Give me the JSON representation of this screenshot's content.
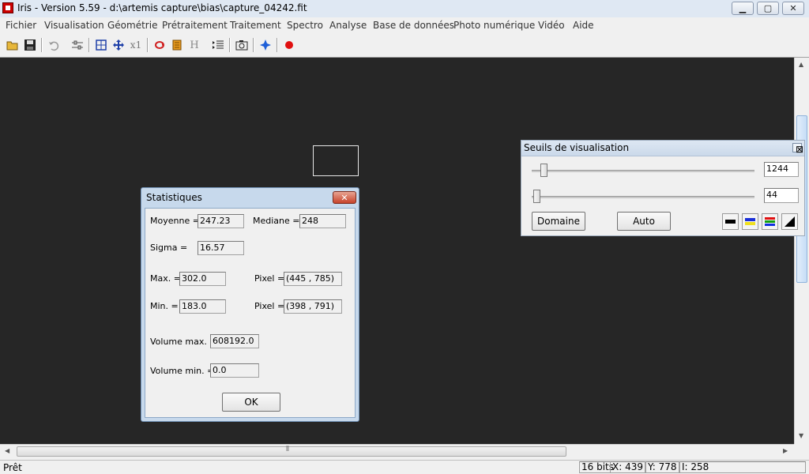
{
  "window": {
    "title": "Iris - Version 5.59 - d:\\artemis capture\\bias\\capture_04242.fit"
  },
  "menu": [
    "Fichier",
    "Visualisation",
    "Géométrie",
    "Prétraitement",
    "Traitement",
    "Spectro",
    "Analyse",
    "Base de données",
    "Photo numérique",
    "Vidéo",
    "Aide"
  ],
  "toolbar": {
    "icons": [
      "open-folder-icon",
      "save-icon",
      "undo-icon",
      "adjust-icon",
      "zoom-fit-icon",
      "move-icon",
      "x1-zoom-icon",
      "rotate-icon",
      "palette-icon",
      "histogram-icon",
      "list-icon",
      "camera-icon",
      "star-icon",
      "record-icon"
    ],
    "x1_label": "x1",
    "h_label": "H"
  },
  "stats_dialog": {
    "title": "Statistiques",
    "close_glyph": "✕",
    "mean_label": "Moyenne =",
    "mean_value": "247.23",
    "median_label": "Mediane =",
    "median_value": "248",
    "sigma_label": "Sigma =",
    "sigma_value": "16.57",
    "max_label": "Max. =",
    "max_value": "302.0",
    "max_pixel_label": "Pixel =",
    "max_pixel_value": "(445 , 785)",
    "min_label": "Min. =",
    "min_value": "183.0",
    "min_pixel_label": "Pixel =",
    "min_pixel_value": "(398 , 791)",
    "vol_max_label": "Volume max. =",
    "vol_max_value": "608192.0",
    "vol_min_label": "Volume min. =",
    "vol_min_value": "0.0",
    "ok_label": "OK"
  },
  "threshold_panel": {
    "title": "Seuils de visualisation",
    "close_glyph": "⊠",
    "high_value": "1244",
    "low_value": "44",
    "domain_label": "Domaine",
    "auto_label": "Auto",
    "swatches": [
      "black-palette-icon",
      "blue-yellow-palette-icon",
      "rgb-palette-icon",
      "gradient-palette-icon"
    ]
  },
  "status": {
    "text": "Prêt",
    "bits": "16 bits",
    "x": "X: 439",
    "y": "Y: 778",
    "i": "I: 258"
  },
  "colors": {
    "workspace": "#262626",
    "dialog_frame": "#c7d9ec",
    "close_red": "#c7432a"
  }
}
